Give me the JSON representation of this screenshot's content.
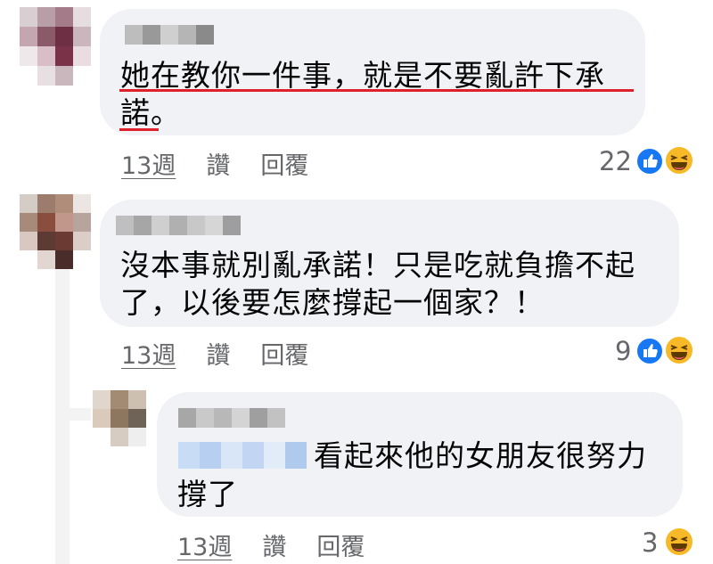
{
  "comments": [
    {
      "text_line1": "她在教你一件事，就是不要亂許下承",
      "text_line2": "諾。",
      "time": "13週",
      "like": "讚",
      "reply": "回覆",
      "reaction_count": "22",
      "reactions": [
        "like-icon",
        "haha-icon"
      ]
    },
    {
      "text_line1": "沒本事就別亂承諾！只是吃就負擔不起",
      "text_line2": "了，以後要怎麼撐起一個家？！",
      "time": "13週",
      "like": "讚",
      "reply": "回覆",
      "reaction_count": "9",
      "reactions": [
        "like-icon",
        "haha-icon"
      ]
    },
    {
      "text_line1": "看起來他的女朋友很努力",
      "text_line2": "撐了",
      "time": "13週",
      "like": "讚",
      "reply": "回覆",
      "reaction_count": "3",
      "reactions": [
        "haha-icon"
      ]
    }
  ],
  "colors": {
    "bubble": "#f0f2f5",
    "meta_text": "#65676b",
    "underline_red": "#e0202a",
    "like_blue": "#1877f2",
    "haha_yellow": "#f7b928"
  }
}
